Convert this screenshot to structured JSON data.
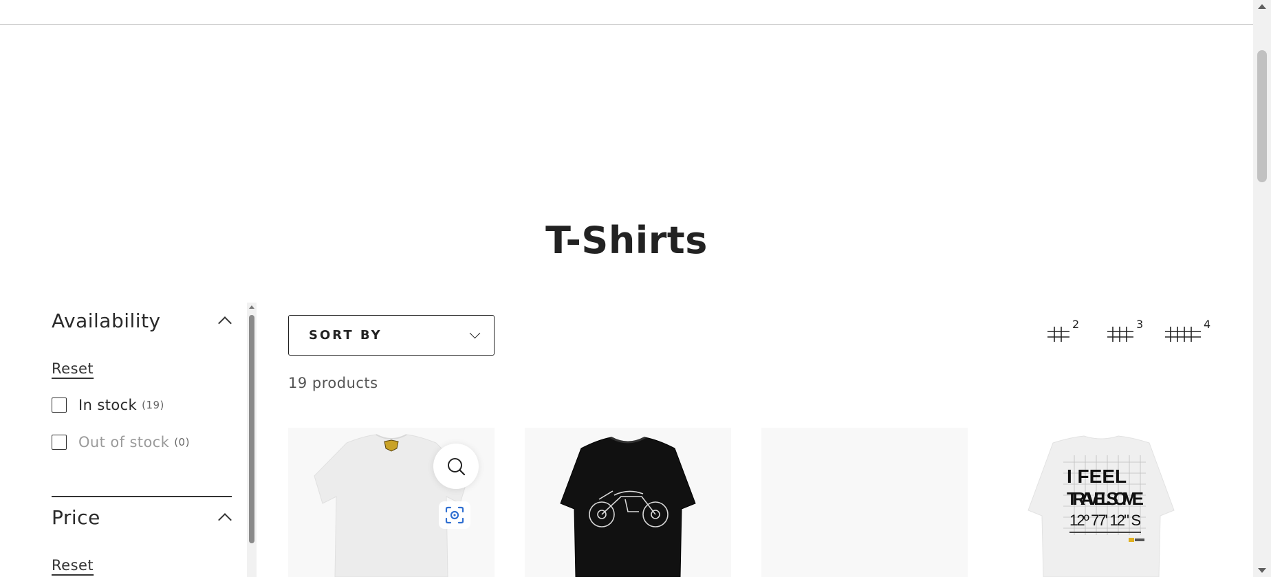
{
  "collection": {
    "title": "T-Shirts",
    "product_count": "19 products"
  },
  "filters": {
    "availability": {
      "title": "Availability",
      "reset_label": "Reset",
      "options": [
        {
          "label": "In stock",
          "count": "(19)",
          "checked": false,
          "disabled": false
        },
        {
          "label": "Out of stock",
          "count": "(0)",
          "checked": false,
          "disabled": true
        }
      ]
    },
    "price": {
      "title": "Price",
      "reset_label": "Reset"
    }
  },
  "toolbar": {
    "sort_label": "SORT BY",
    "grid_options": [
      "2",
      "3",
      "4"
    ]
  },
  "products": [
    {
      "color": "white-tshirt-back",
      "tag": "small logo",
      "quick_view": true
    },
    {
      "color": "black-tshirt-motorcycle-print"
    },
    {
      "color": "image-loading-placeholder"
    },
    {
      "color": "white-tshirt-travel-print",
      "print_lines": [
        "I FEEL",
        "TRAVELSOME",
        "12º 77' 12\" S"
      ]
    }
  ],
  "theme": {
    "text": "#222222",
    "card_bg": "#f8f8f8",
    "accent_blue": "#2f6fd1"
  }
}
